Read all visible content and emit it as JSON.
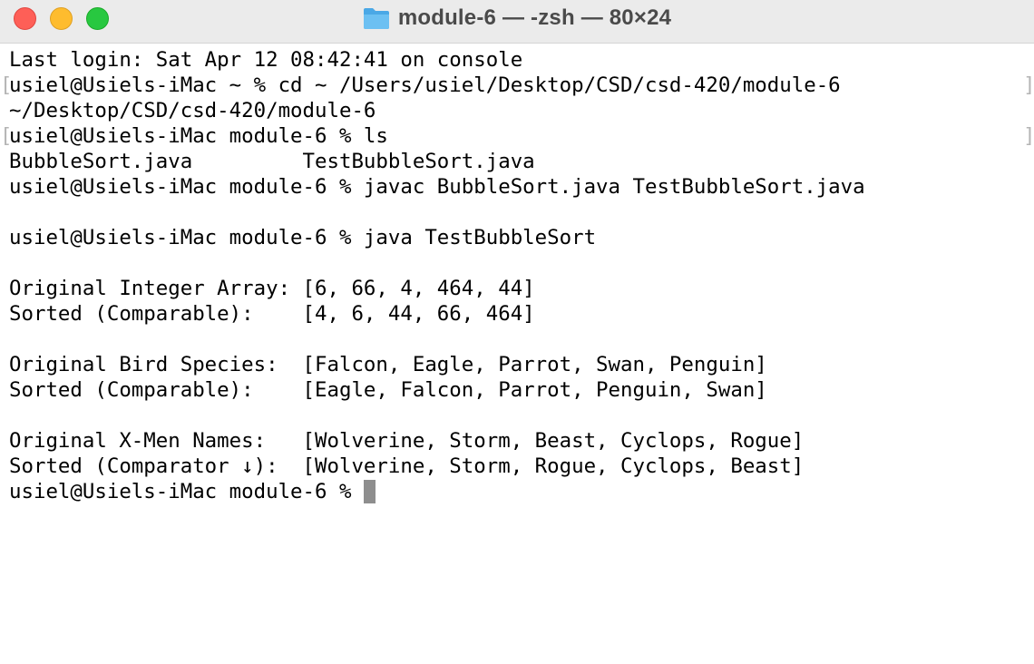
{
  "window": {
    "title": "module-6 — -zsh — 80×24"
  },
  "terminal": {
    "lines": [
      "Last login: Sat Apr 12 08:42:41 on console",
      "usiel@Usiels-iMac ~ % cd ~ /Users/usiel/Desktop/CSD/csd-420/module-6",
      "~/Desktop/CSD/csd-420/module-6",
      "usiel@Usiels-iMac module-6 % ls",
      "BubbleSort.java         TestBubbleSort.java",
      "usiel@Usiels-iMac module-6 % javac BubbleSort.java TestBubbleSort.java",
      "",
      "usiel@Usiels-iMac module-6 % java TestBubbleSort",
      "",
      "Original Integer Array: [6, 66, 4, 464, 44]",
      "Sorted (Comparable):    [4, 6, 44, 66, 464]",
      "",
      "Original Bird Species:  [Falcon, Eagle, Parrot, Swan, Penguin]",
      "Sorted (Comparable):    [Eagle, Falcon, Parrot, Penguin, Swan]",
      "",
      "Original X-Men Names:   [Wolverine, Storm, Beast, Cyclops, Rogue]",
      "Sorted (Comparator ↓):  [Wolverine, Storm, Rogue, Cyclops, Beast]"
    ],
    "prompt": "usiel@Usiels-iMac module-6 % ",
    "mark_open": "[",
    "mark_close": "]"
  },
  "icons": {
    "folder": "folder-icon"
  },
  "colors": {
    "close": "#fe5f57",
    "minimize": "#febc2e",
    "zoom": "#28c840",
    "titlebar": "#ebebeb",
    "cursor": "#8e8e8e"
  }
}
